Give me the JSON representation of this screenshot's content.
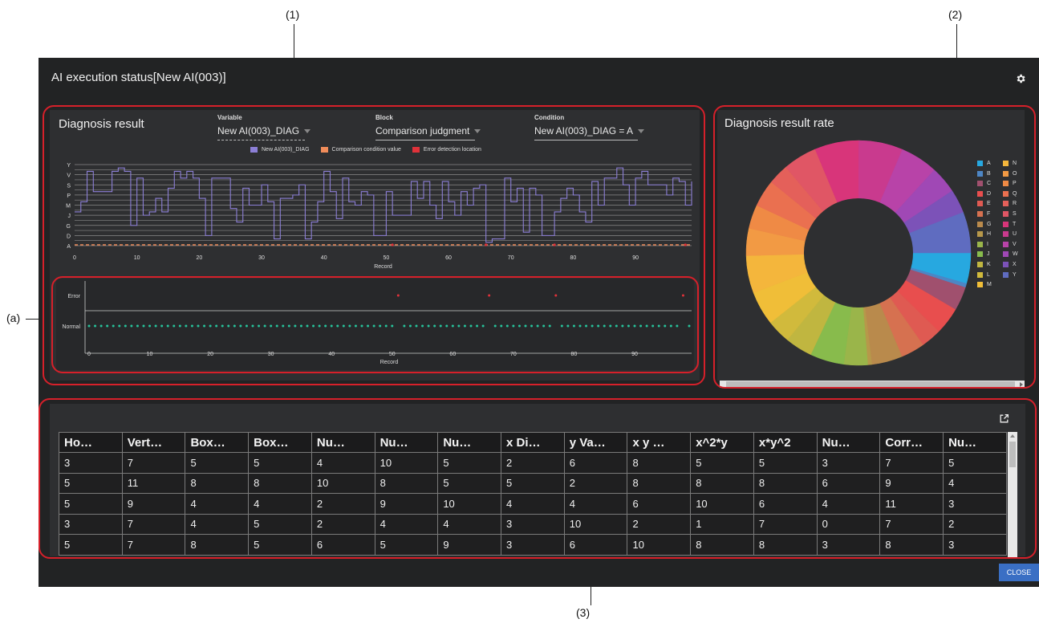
{
  "callouts": {
    "one": "(1)",
    "two": "(2)",
    "three": "(3)",
    "a": "(a)"
  },
  "window": {
    "title": "AI execution status[New AI(003)]",
    "close_label": "CLOSE"
  },
  "diagnosis": {
    "title": "Diagnosis result",
    "variable": {
      "label": "Variable",
      "value": "New AI(003)_DIAG"
    },
    "block": {
      "label": "Block",
      "value": "Comparison judgment"
    },
    "condition": {
      "label": "Condition",
      "value": "New AI(003)_DIAG = A"
    },
    "legend": [
      {
        "name": "New AI(003)_DIAG",
        "color": "#8c7fd6"
      },
      {
        "name": "Comparison condition value",
        "color": "#f08c5a"
      },
      {
        "name": "Error detection location",
        "color": "#e0323a"
      }
    ]
  },
  "rate": {
    "title": "Diagnosis result rate"
  },
  "chart_data": [
    {
      "type": "line",
      "xlabel": "Record",
      "xlim": [
        0,
        99
      ],
      "x_ticks": [
        0,
        10,
        20,
        30,
        40,
        50,
        60,
        70,
        80,
        90
      ],
      "y_ticks": [
        "A",
        "D",
        "G",
        "J",
        "M",
        "P",
        "S",
        "V",
        "Y"
      ],
      "series": [
        {
          "name": "New AI(003)_DIAG",
          "color": "#8c7fd6",
          "values": [
            10,
            13,
            22,
            16,
            16,
            16,
            22,
            23,
            22,
            6,
            20,
            9,
            10,
            14,
            10,
            17,
            22,
            20,
            22,
            20,
            14,
            3,
            20,
            20,
            20,
            11,
            7,
            17,
            12,
            12,
            18,
            13,
            2,
            14,
            14,
            15,
            18,
            2,
            7,
            13,
            22,
            16,
            8,
            20,
            13,
            12,
            16,
            15,
            3,
            3,
            16,
            9,
            9,
            9,
            19,
            14,
            19,
            12,
            8,
            19,
            13,
            9,
            16,
            12,
            17,
            18,
            1,
            2,
            2,
            20,
            13,
            17,
            4,
            17,
            15,
            3,
            3,
            10,
            14,
            17,
            15,
            10,
            7,
            19,
            12,
            20,
            20,
            23,
            18,
            12,
            20,
            22,
            18,
            18,
            18,
            15,
            20,
            19,
            12,
            19
          ]
        },
        {
          "name": "Comparison condition value",
          "color": "#f08c5a",
          "constant": 0
        }
      ],
      "error_points": [
        51,
        66,
        77,
        98
      ]
    },
    {
      "type": "scatter",
      "xlabel": "Record",
      "xlim": [
        0,
        99
      ],
      "x_ticks": [
        0,
        10,
        20,
        30,
        40,
        50,
        60,
        70,
        80,
        90
      ],
      "categories": [
        "Normal",
        "Error"
      ],
      "error_records": [
        51,
        66,
        77,
        98
      ],
      "normal_color": "#27c29a",
      "error_color": "#e0323a"
    },
    {
      "type": "pie",
      "donut": true,
      "labels": [
        "A",
        "B",
        "C",
        "D",
        "E",
        "F",
        "G",
        "H",
        "I",
        "J",
        "K",
        "L",
        "M",
        "N",
        "O",
        "P",
        "Q",
        "R",
        "S",
        "T",
        "U",
        "V",
        "W",
        "X",
        "Y"
      ],
      "colors": [
        "#27a8e0",
        "#4d86c4",
        "#a0506e",
        "#e84e4e",
        "#df5a52",
        "#d67150",
        "#b98a4c",
        "#b7984a",
        "#9ab54a",
        "#88bb4c",
        "#c0b640",
        "#d1ba3c",
        "#f0be38",
        "#f4b63c",
        "#f29a44",
        "#ef8a45",
        "#ea7050",
        "#e4605a",
        "#e05665",
        "#d8357a",
        "#c93a8e",
        "#b843a8",
        "#a048b5",
        "#7c52b8",
        "#5f6cc0"
      ],
      "values": [
        4.5,
        0.6,
        3.5,
        4.0,
        3.0,
        3.5,
        4.5,
        0.6,
        3.5,
        5.0,
        4.0,
        3.5,
        5.0,
        5.5,
        4.0,
        3.5,
        4.0,
        3.0,
        5.0,
        6.5,
        6.5,
        5.5,
        4.0,
        3.5,
        6.0
      ]
    }
  ],
  "table": {
    "headers": [
      "Ho…",
      "Vert…",
      "Box…",
      "Box…",
      "Nu…",
      "Nu…",
      "Nu…",
      "x Di…",
      "y Va…",
      "x y …",
      "x^2*y",
      "x*y^2",
      "Nu…",
      "Corr…",
      "Nu…"
    ],
    "rows": [
      [
        "3",
        "7",
        "5",
        "5",
        "4",
        "10",
        "5",
        "2",
        "6",
        "8",
        "5",
        "5",
        "3",
        "7",
        "5"
      ],
      [
        "5",
        "11",
        "8",
        "8",
        "10",
        "8",
        "5",
        "5",
        "2",
        "8",
        "8",
        "8",
        "6",
        "9",
        "4"
      ],
      [
        "5",
        "9",
        "4",
        "4",
        "2",
        "9",
        "10",
        "4",
        "4",
        "6",
        "10",
        "6",
        "4",
        "11",
        "3"
      ],
      [
        "3",
        "7",
        "4",
        "5",
        "2",
        "4",
        "4",
        "3",
        "10",
        "2",
        "1",
        "7",
        "0",
        "7",
        "2"
      ],
      [
        "5",
        "7",
        "8",
        "5",
        "6",
        "5",
        "9",
        "3",
        "6",
        "10",
        "8",
        "8",
        "3",
        "8",
        "3"
      ]
    ]
  }
}
